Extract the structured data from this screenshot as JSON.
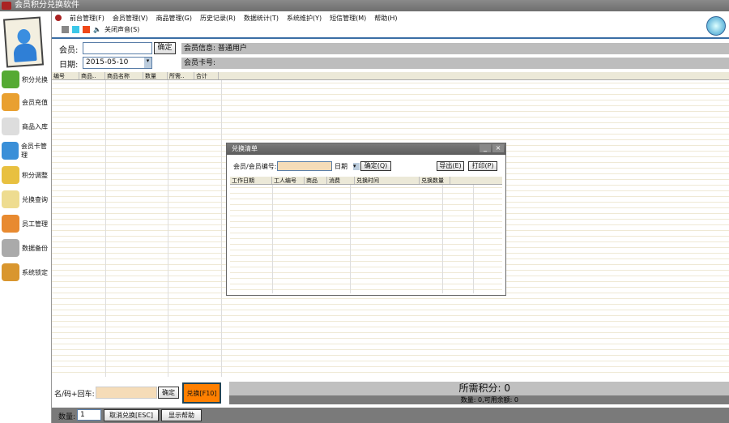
{
  "window": {
    "title": "会员积分兑换软件"
  },
  "menu": [
    "前台管理(F)",
    "会员管理(V)",
    "商品管理(G)",
    "历史记录(R)",
    "数据统计(T)",
    "系统维护(Y)",
    "短信管理(M)",
    "帮助(H)"
  ],
  "toolbar": {
    "sound_label": "关闭声音(S)"
  },
  "sidebar": [
    "积分兑换",
    "会员充值",
    "商品入库",
    "会员卡管理",
    "积分调整",
    "兑换查询",
    "员工管理",
    "数据备份",
    "系统锁定"
  ],
  "form": {
    "member_label": "会员:",
    "member_value": "",
    "confirm": "确定",
    "date_label": "日期:",
    "date_value": "2015-05-10",
    "member_info": "会员信息: 普通用户",
    "card_label": "会员卡号:"
  },
  "grid": {
    "columns": [
      "编号",
      "商品..",
      "商品名称",
      "数量",
      "所需..",
      "合计"
    ]
  },
  "dialog": {
    "title": "兑换清单",
    "search_label": "会员/会员编号:",
    "search_value": "",
    "date_short": "日期",
    "confirm": "确定(Q)",
    "export": "导出(E)",
    "print": "打印(P)",
    "columns": [
      "工作日期",
      "工人编号",
      "商品",
      "消费",
      "兑换时间",
      "兑换数量"
    ]
  },
  "bottom": {
    "code_label": "名/码+回车:",
    "code_value": "",
    "confirm": "确定",
    "exchange": "兑换[F10]",
    "points": "所需积分: 0",
    "balance": "数量: 0,可用余额: 0",
    "qty_label": "数量:",
    "qty_value": "1",
    "cancel": "取消兑换[ESC]",
    "help": "显示帮助"
  }
}
